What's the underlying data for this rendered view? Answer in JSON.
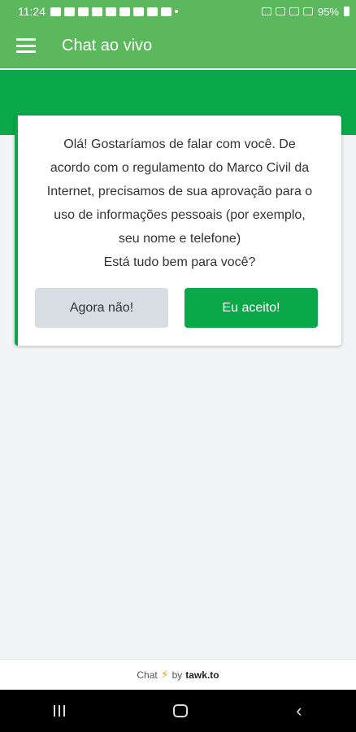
{
  "status_bar": {
    "time": "11:24",
    "battery": "95%"
  },
  "app_bar": {
    "title": "Chat ao vivo"
  },
  "consent": {
    "message_lines": [
      "Olá! Gostaríamos de falar com você. De",
      "acordo com o regulamento do Marco Civil da",
      "Internet, precisamos de sua aprovação para o",
      "uso de informações pessoais (por exemplo,",
      "seu nome e telefone)",
      "Está tudo bem para você?"
    ],
    "decline_label": "Agora não!",
    "accept_label": "Eu aceito!"
  },
  "footer": {
    "chat": "Chat",
    "by": "by",
    "brand": "tawk.to"
  },
  "colors": {
    "app_bar": "#5cb85c",
    "accent": "#0ba84a",
    "decline_bg": "#d8dce3"
  }
}
